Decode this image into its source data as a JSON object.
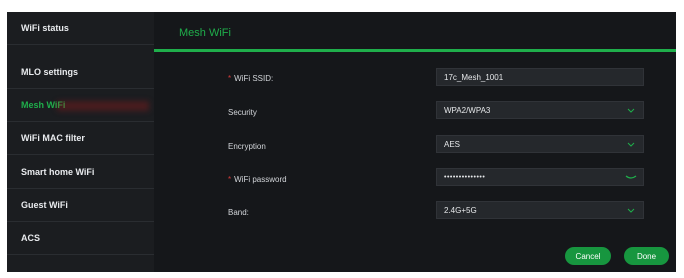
{
  "sidebar": {
    "items": [
      {
        "label": "WiFi status"
      },
      {
        "label": "MLO settings"
      },
      {
        "label": "Mesh WiFi"
      },
      {
        "label": "WiFi MAC filter"
      },
      {
        "label": "Smart home WiFi"
      },
      {
        "label": "Guest WiFi"
      },
      {
        "label": "ACS"
      }
    ],
    "active_index": 2
  },
  "main": {
    "title": "Mesh WiFi",
    "fields": {
      "ssid": {
        "required_mark": "*",
        "label": "WiFi SSID:",
        "value": "17c_Mesh_1001"
      },
      "security": {
        "label": "Security",
        "value": "WPA2/WPA3"
      },
      "encryption": {
        "label": "Encryption",
        "value": "AES"
      },
      "password": {
        "required_mark": "*",
        "label": "WiFi password",
        "value": "••••••••••••••"
      },
      "band": {
        "label": "Band:",
        "value": "2.4G+5G"
      }
    },
    "buttons": {
      "cancel": "Cancel",
      "done": "Done"
    }
  },
  "colors": {
    "accent": "#1fae4b",
    "button": "#17963f",
    "background": "#121417",
    "sidebar": "#1b1d20",
    "required": "#d23a3a"
  },
  "icons": [
    "chevron-down-icon",
    "eye-toggle-icon"
  ]
}
